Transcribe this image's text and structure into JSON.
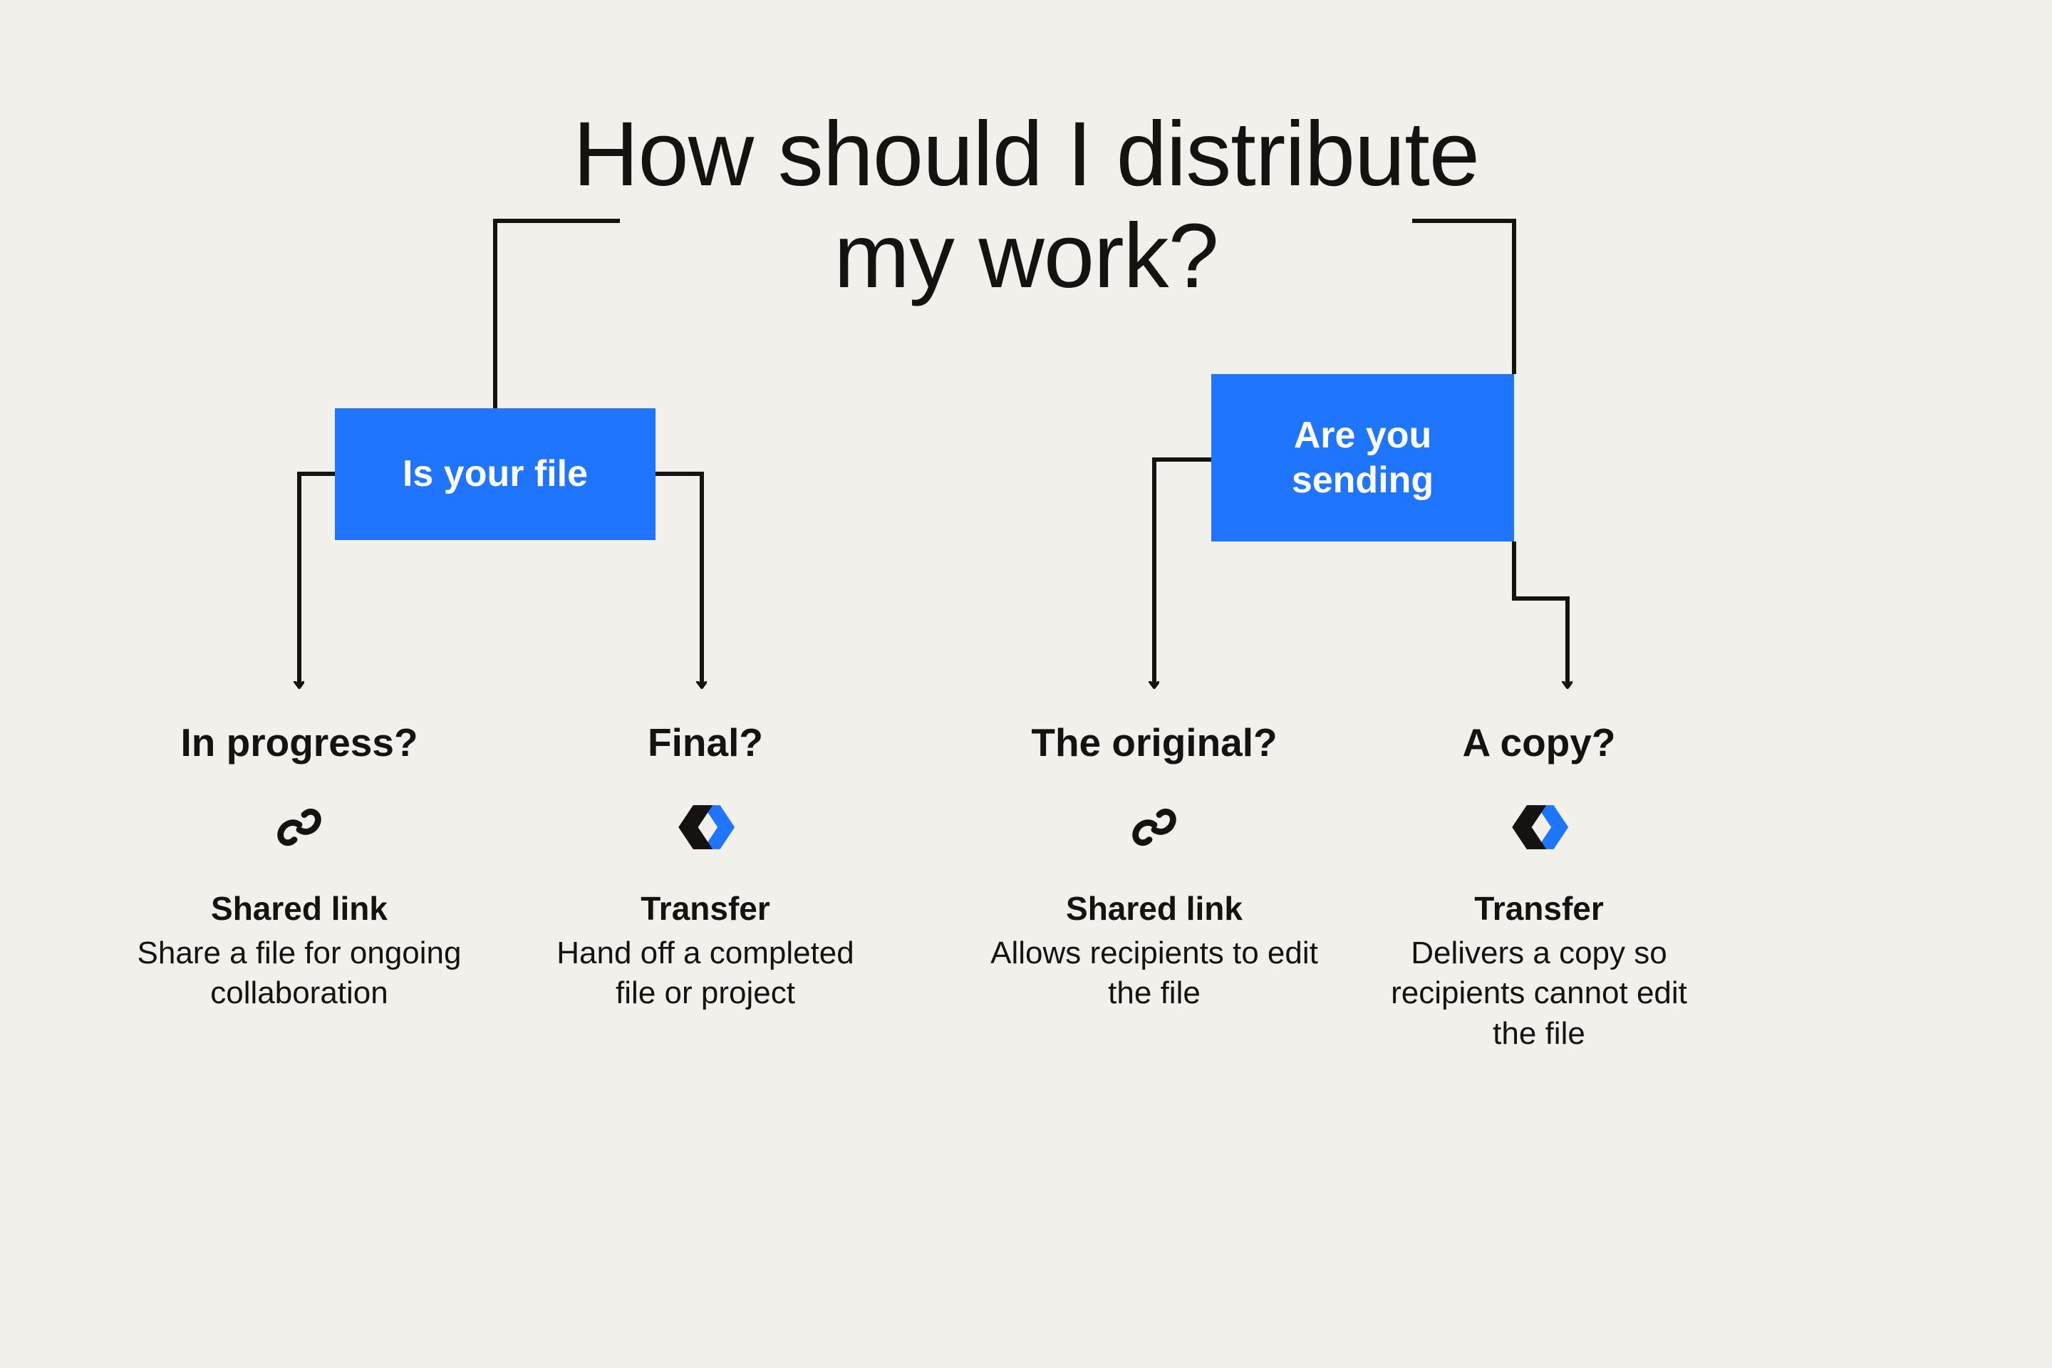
{
  "title": "How should I distribute my work?",
  "colors": {
    "background": "#f1f0eb",
    "accent": "#1f75fe",
    "text": "#14130f",
    "iconDark": "#1a1918"
  },
  "decisions": {
    "left": "Is your file",
    "right": "Are you sending"
  },
  "leaves": [
    {
      "question": "In progress?",
      "icon": "link-icon",
      "name": "Shared link",
      "desc": "Share a file for ongoing collaboration"
    },
    {
      "question": "Final?",
      "icon": "transfer-icon",
      "name": "Transfer",
      "desc": "Hand off a completed file or project"
    },
    {
      "question": "The original?",
      "icon": "link-icon",
      "name": "Shared link",
      "desc": "Allows recipients to edit the file"
    },
    {
      "question": "A copy?",
      "icon": "transfer-icon",
      "name": "Transfer",
      "desc": "Delivers a copy so recipients cannot edit the file"
    }
  ]
}
